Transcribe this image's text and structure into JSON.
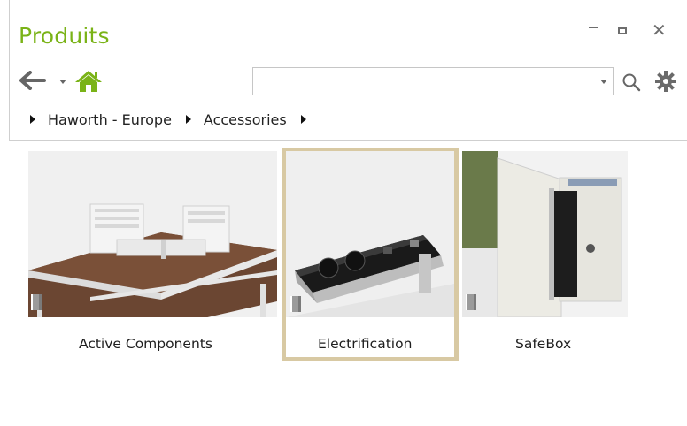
{
  "window": {
    "title": "Produits",
    "controls": [
      "minimize",
      "maximize",
      "close"
    ],
    "close_glyph": "✕"
  },
  "toolbar": {
    "back_icon": "arrow-left-icon",
    "home_icon": "home-icon",
    "search_value": "",
    "search_icon": "search-icon",
    "settings_icon": "gear-icon"
  },
  "breadcrumb": [
    "Haworth - Europe",
    "Accessories"
  ],
  "tiles": [
    {
      "label": "Active Components",
      "selected": false
    },
    {
      "label": "Electrification",
      "selected": true
    },
    {
      "label": "SafeBox",
      "selected": false
    }
  ],
  "colors": {
    "title": "#7ab317",
    "selection_border": "#d8c9a3"
  }
}
